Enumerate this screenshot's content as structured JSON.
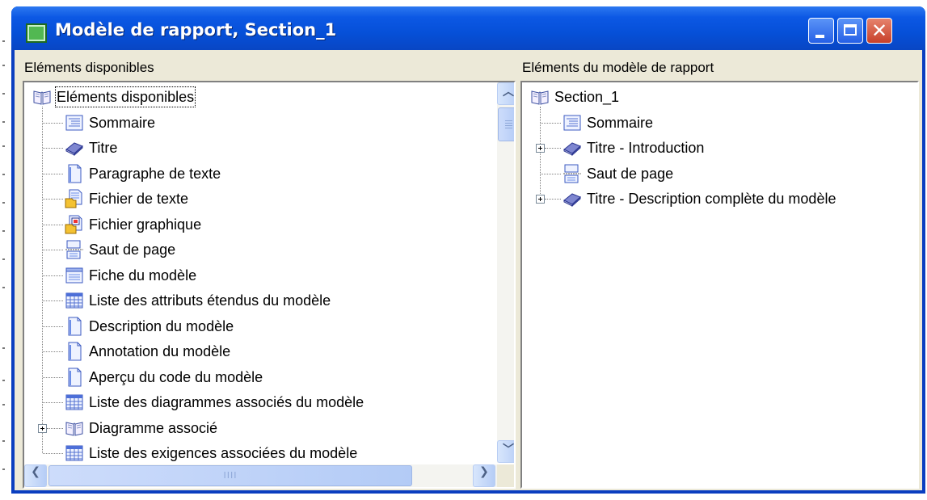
{
  "window": {
    "title": "Modèle de rapport, Section_1",
    "close_glyph": "✕"
  },
  "left_pane": {
    "header": "Eléments disponibles",
    "root": {
      "label": "Eléments disponibles",
      "icon": "open-book-icon"
    },
    "items": [
      {
        "label": "Sommaire",
        "icon": "toc-list-icon",
        "expandable": false
      },
      {
        "label": "Titre",
        "icon": "title-book-icon",
        "expandable": false
      },
      {
        "label": "Paragraphe de texte",
        "icon": "document-icon",
        "expandable": false
      },
      {
        "label": "Fichier de texte",
        "icon": "text-file-icon",
        "expandable": false
      },
      {
        "label": "Fichier graphique",
        "icon": "graphic-file-icon",
        "expandable": false
      },
      {
        "label": "Saut de page",
        "icon": "page-break-icon",
        "expandable": false
      },
      {
        "label": "Fiche du modèle",
        "icon": "card-icon",
        "expandable": false
      },
      {
        "label": "Liste des attributs étendus du modèle",
        "icon": "grid-list-icon",
        "expandable": false
      },
      {
        "label": "Description du modèle",
        "icon": "document-icon",
        "expandable": false
      },
      {
        "label": "Annotation du modèle",
        "icon": "document-icon",
        "expandable": false
      },
      {
        "label": "Aperçu du code du modèle",
        "icon": "document-icon",
        "expandable": false
      },
      {
        "label": "Liste des diagrammes associés du modèle",
        "icon": "grid-list-icon",
        "expandable": false
      },
      {
        "label": "Diagramme associé",
        "icon": "open-book-icon",
        "expandable": true
      },
      {
        "label": "Liste des exigences associées du modèle",
        "icon": "grid-list-icon",
        "expandable": false
      }
    ],
    "hscroll_grip": "IIII"
  },
  "right_pane": {
    "header": "Eléments du modèle de rapport",
    "root": {
      "label": "Section_1",
      "icon": "open-book-icon"
    },
    "items": [
      {
        "label": "Sommaire",
        "icon": "toc-list-icon",
        "expandable": false
      },
      {
        "label": "Titre - Introduction",
        "icon": "title-book-icon",
        "expandable": true
      },
      {
        "label": "Saut de page",
        "icon": "page-break-icon",
        "expandable": false
      },
      {
        "label": "Titre - Description complète du modèle",
        "icon": "title-book-icon",
        "expandable": true
      }
    ]
  }
}
